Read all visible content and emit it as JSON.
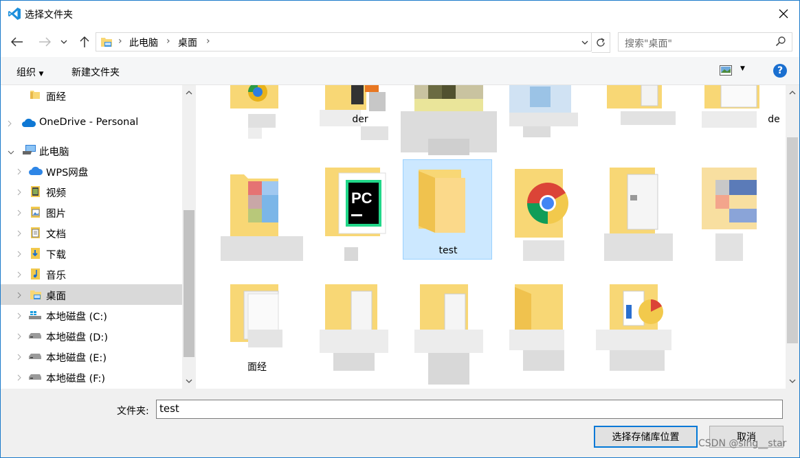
{
  "window": {
    "title": "选择文件夹",
    "close_icon": "close-icon"
  },
  "nav": {
    "breadcrumb": [
      "此电脑",
      "桌面"
    ],
    "search_placeholder": "搜索\"桌面\""
  },
  "toolbar": {
    "organize": "组织",
    "new_folder": "新建文件夹",
    "help": "?"
  },
  "tree": {
    "items": [
      {
        "label": "面经",
        "icon": "folder-icon"
      },
      {
        "label": "OneDrive - Personal",
        "icon": "onedrive-icon"
      },
      {
        "label": "此电脑",
        "icon": "computer-icon"
      },
      {
        "label": "WPS网盘",
        "icon": "cloud-icon"
      },
      {
        "label": "视频",
        "icon": "video-folder-icon"
      },
      {
        "label": "图片",
        "icon": "pictures-folder-icon"
      },
      {
        "label": "文档",
        "icon": "documents-folder-icon"
      },
      {
        "label": "下载",
        "icon": "downloads-folder-icon"
      },
      {
        "label": "音乐",
        "icon": "music-folder-icon"
      },
      {
        "label": "桌面",
        "icon": "desktop-folder-icon",
        "selected": true
      },
      {
        "label": "本地磁盘 (C:)",
        "icon": "windows-drive-icon"
      },
      {
        "label": "本地磁盘 (D:)",
        "icon": "drive-icon"
      },
      {
        "label": "本地磁盘 (E:)",
        "icon": "drive-icon"
      },
      {
        "label": "本地磁盘 (F:)",
        "icon": "drive-icon"
      }
    ]
  },
  "files": {
    "row1_partial_labels": [
      "der",
      "de"
    ],
    "test_label": "test",
    "mianjing_label": "面经"
  },
  "bottom": {
    "folder_label": "文件夹:",
    "folder_value": "test",
    "select_button": "选择存储库位置",
    "cancel_button": "取消"
  },
  "watermark": "CSDN @sing__star",
  "colors": {
    "accent": "#0078d7",
    "selection": "#cce8ff",
    "folder": "#f8d775"
  }
}
